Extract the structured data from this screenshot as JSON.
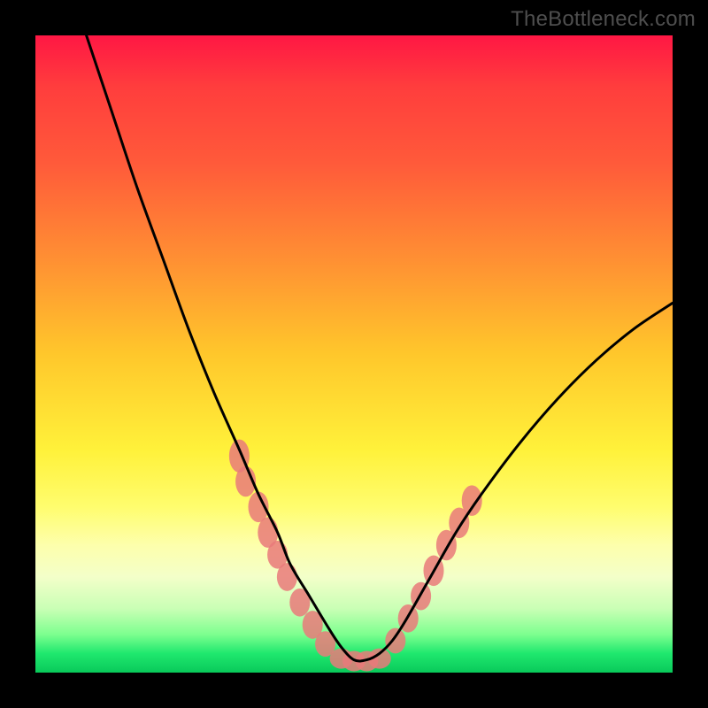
{
  "watermark": "TheBottleneck.com",
  "chart_data": {
    "type": "line",
    "title": "",
    "xlabel": "",
    "ylabel": "",
    "xlim": [
      0,
      100
    ],
    "ylim": [
      0,
      100
    ],
    "grid": false,
    "legend": false,
    "series": [
      {
        "name": "bottleneck-curve",
        "stroke": "#000000",
        "x": [
          8,
          12,
          16,
          20,
          24,
          28,
          32,
          35,
          38,
          40,
          43,
          46,
          48,
          50,
          52,
          54,
          56,
          58,
          62,
          66,
          70,
          76,
          82,
          88,
          94,
          100
        ],
        "y": [
          100,
          88,
          76,
          65,
          54,
          44,
          35,
          28,
          22,
          17,
          12,
          7,
          4,
          2,
          2,
          3,
          5,
          8,
          15,
          22,
          28,
          36,
          43,
          49,
          54,
          58
        ]
      }
    ],
    "markers": [
      {
        "name": "left-cluster",
        "fill": "#e97a7a",
        "points": [
          {
            "x": 32.0,
            "y": 34.0,
            "rx": 1.6,
            "ry": 2.6
          },
          {
            "x": 33.0,
            "y": 30.0,
            "rx": 1.6,
            "ry": 2.4
          },
          {
            "x": 35.0,
            "y": 26.0,
            "rx": 1.6,
            "ry": 2.4
          },
          {
            "x": 36.5,
            "y": 22.0,
            "rx": 1.6,
            "ry": 2.4
          },
          {
            "x": 38.0,
            "y": 18.5,
            "rx": 1.6,
            "ry": 2.2
          },
          {
            "x": 39.5,
            "y": 15.0,
            "rx": 1.6,
            "ry": 2.2
          },
          {
            "x": 41.5,
            "y": 11.0,
            "rx": 1.6,
            "ry": 2.2
          },
          {
            "x": 43.5,
            "y": 7.5,
            "rx": 1.6,
            "ry": 2.2
          },
          {
            "x": 45.5,
            "y": 4.5,
            "rx": 1.6,
            "ry": 2.0
          }
        ]
      },
      {
        "name": "trough-band",
        "fill": "#e97a7a",
        "points": [
          {
            "x": 48.0,
            "y": 2.2,
            "rx": 1.8,
            "ry": 1.6
          },
          {
            "x": 50.0,
            "y": 1.8,
            "rx": 1.8,
            "ry": 1.6
          },
          {
            "x": 52.0,
            "y": 1.8,
            "rx": 1.8,
            "ry": 1.6
          },
          {
            "x": 54.0,
            "y": 2.2,
            "rx": 1.8,
            "ry": 1.6
          }
        ]
      },
      {
        "name": "right-cluster",
        "fill": "#e97a7a",
        "points": [
          {
            "x": 56.5,
            "y": 5.0,
            "rx": 1.6,
            "ry": 2.0
          },
          {
            "x": 58.5,
            "y": 8.5,
            "rx": 1.6,
            "ry": 2.2
          },
          {
            "x": 60.5,
            "y": 12.0,
            "rx": 1.6,
            "ry": 2.2
          },
          {
            "x": 62.5,
            "y": 16.0,
            "rx": 1.6,
            "ry": 2.4
          },
          {
            "x": 64.5,
            "y": 20.0,
            "rx": 1.6,
            "ry": 2.4
          },
          {
            "x": 66.5,
            "y": 23.5,
            "rx": 1.6,
            "ry": 2.4
          },
          {
            "x": 68.5,
            "y": 27.0,
            "rx": 1.6,
            "ry": 2.4
          }
        ]
      }
    ],
    "gradient_bands": [
      {
        "color": "#ff1744",
        "stop": 0
      },
      {
        "color": "#ffc72b",
        "stop": 50
      },
      {
        "color": "#fdffac",
        "stop": 80
      },
      {
        "color": "#1fe86e",
        "stop": 97
      }
    ]
  }
}
